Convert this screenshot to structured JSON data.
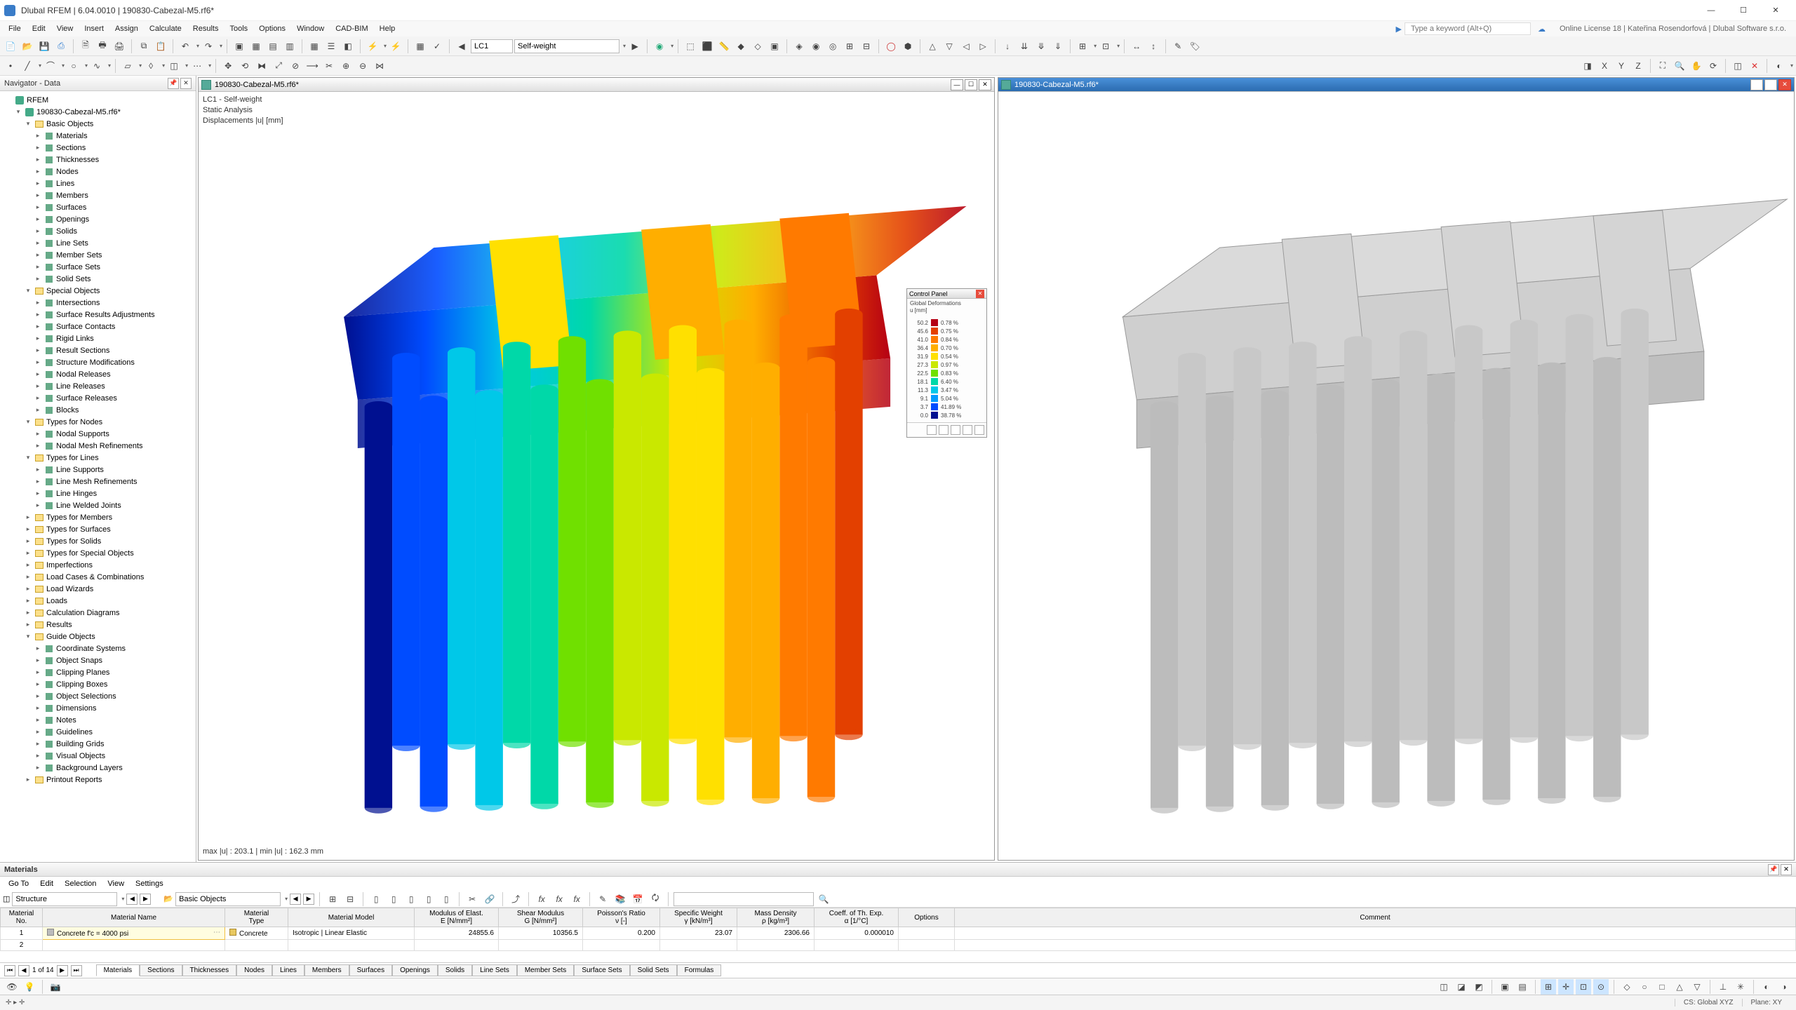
{
  "app": {
    "title": "Dlubal RFEM | 6.04.0010 | 190830-Cabezal-M5.rf6*",
    "license": "Online License 18 | Kateřina Rosendorfová | Dlubal Software s.r.o.",
    "search_hint": "Type a keyword (Alt+Q)"
  },
  "menu": [
    "File",
    "Edit",
    "View",
    "Insert",
    "Assign",
    "Calculate",
    "Results",
    "Tools",
    "Options",
    "Window",
    "CAD-BIM",
    "Help"
  ],
  "toolbar2": {
    "lc_code": "LC1",
    "lc_name": "Self-weight"
  },
  "navigator": {
    "title": "Navigator - Data",
    "root": "RFEM",
    "model": "190830-Cabezal-M5.rf6*",
    "groups": [
      {
        "label": "Basic Objects",
        "open": true,
        "children": [
          "Materials",
          "Sections",
          "Thicknesses",
          "Nodes",
          "Lines",
          "Members",
          "Surfaces",
          "Openings",
          "Solids",
          "Line Sets",
          "Member Sets",
          "Surface Sets",
          "Solid Sets"
        ]
      },
      {
        "label": "Special Objects",
        "open": true,
        "children": [
          "Intersections",
          "Surface Results Adjustments",
          "Surface Contacts",
          "Rigid Links",
          "Result Sections",
          "Structure Modifications",
          "Nodal Releases",
          "Line Releases",
          "Surface Releases",
          "Blocks"
        ]
      },
      {
        "label": "Types for Nodes",
        "open": true,
        "children": [
          "Nodal Supports",
          "Nodal Mesh Refinements"
        ]
      },
      {
        "label": "Types for Lines",
        "open": true,
        "children": [
          "Line Supports",
          "Line Mesh Refinements",
          "Line Hinges",
          "Line Welded Joints"
        ]
      },
      {
        "label": "Types for Members",
        "open": false
      },
      {
        "label": "Types for Surfaces",
        "open": false
      },
      {
        "label": "Types for Solids",
        "open": false
      },
      {
        "label": "Types for Special Objects",
        "open": false
      },
      {
        "label": "Imperfections",
        "open": false
      },
      {
        "label": "Load Cases & Combinations",
        "open": false
      },
      {
        "label": "Load Wizards",
        "open": false
      },
      {
        "label": "Loads",
        "open": false
      },
      {
        "label": "Calculation Diagrams",
        "open": false
      },
      {
        "label": "Results",
        "open": false
      },
      {
        "label": "Guide Objects",
        "open": true,
        "children": [
          "Coordinate Systems",
          "Object Snaps",
          "Clipping Planes",
          "Clipping Boxes",
          "Object Selections",
          "Dimensions",
          "Notes",
          "Guidelines",
          "Building Grids",
          "Visual Objects",
          "Background Layers"
        ]
      },
      {
        "label": "Printout Reports",
        "open": false
      }
    ]
  },
  "viewport": {
    "left_title": "190830-Cabezal-M5.rf6*",
    "right_title": "190830-Cabezal-M5.rf6*",
    "info": [
      "LC1 - Self-weight",
      "Static Analysis",
      "Displacements |u| [mm]"
    ],
    "footer": "max |u| : 203.1 | min |u| : 162.3 mm"
  },
  "control_panel": {
    "title": "Control Panel",
    "subtitle1": "Global Deformations",
    "subtitle2": "u [mm]",
    "rows": [
      {
        "v": "50.2",
        "c": "#b50014",
        "r": "0.78 %"
      },
      {
        "v": "45.6",
        "c": "#e34000",
        "r": "0.75 %"
      },
      {
        "v": "41.0",
        "c": "#ff7a00",
        "r": "0.84 %"
      },
      {
        "v": "36.4",
        "c": "#ffae00",
        "r": "0.70 %"
      },
      {
        "v": "31.9",
        "c": "#ffe000",
        "r": "0.54 %"
      },
      {
        "v": "27.3",
        "c": "#c9e800",
        "r": "0.97 %"
      },
      {
        "v": "22.5",
        "c": "#70e000",
        "r": "0.83 %"
      },
      {
        "v": "18.1",
        "c": "#00d8a8",
        "r": "6.40 %"
      },
      {
        "v": "11.3",
        "c": "#00c8e8",
        "r": "3.47 %"
      },
      {
        "v": "9.1",
        "c": "#009cff",
        "r": "5.04 %"
      },
      {
        "v": "3.7",
        "c": "#004cff",
        "r": "41.89 %"
      },
      {
        "v": "0.0",
        "c": "#001090",
        "r": "38.78 %"
      }
    ]
  },
  "materials": {
    "title": "Materials",
    "menu": [
      "Go To",
      "Edit",
      "Selection",
      "View",
      "Settings"
    ],
    "combo1": "Structure",
    "combo2": "Basic Objects",
    "pager": "1 of 14",
    "headers": {
      "no": "Material\nNo.",
      "name": "Material Name",
      "type": "Material\nType",
      "model": "Material Model",
      "e": "Modulus of Elast.\nE [N/mm²]",
      "g": "Shear Modulus\nG [N/mm²]",
      "v": "Poisson's Ratio\nν [-]",
      "w": "Specific Weight\nγ [kN/m³]",
      "d": "Mass Density\nρ [kg/m³]",
      "a": "Coeff. of Th. Exp.\nα [1/°C]",
      "o": "Options",
      "c": "Comment"
    },
    "row": {
      "no": "1",
      "name": "Concrete f'c = 4000 psi",
      "type": "Concrete",
      "model": "Isotropic | Linear Elastic",
      "e": "24855.6",
      "g": "10356.5",
      "v": "0.200",
      "w": "23.07",
      "d": "2306.66",
      "a": "0.000010"
    },
    "tabs": [
      "Materials",
      "Sections",
      "Thicknesses",
      "Nodes",
      "Lines",
      "Members",
      "Surfaces",
      "Openings",
      "Solids",
      "Line Sets",
      "Member Sets",
      "Surface Sets",
      "Solid Sets",
      "Formulas"
    ]
  },
  "status": {
    "cs": "CS: Global XYZ",
    "plane": "Plane: XY"
  }
}
